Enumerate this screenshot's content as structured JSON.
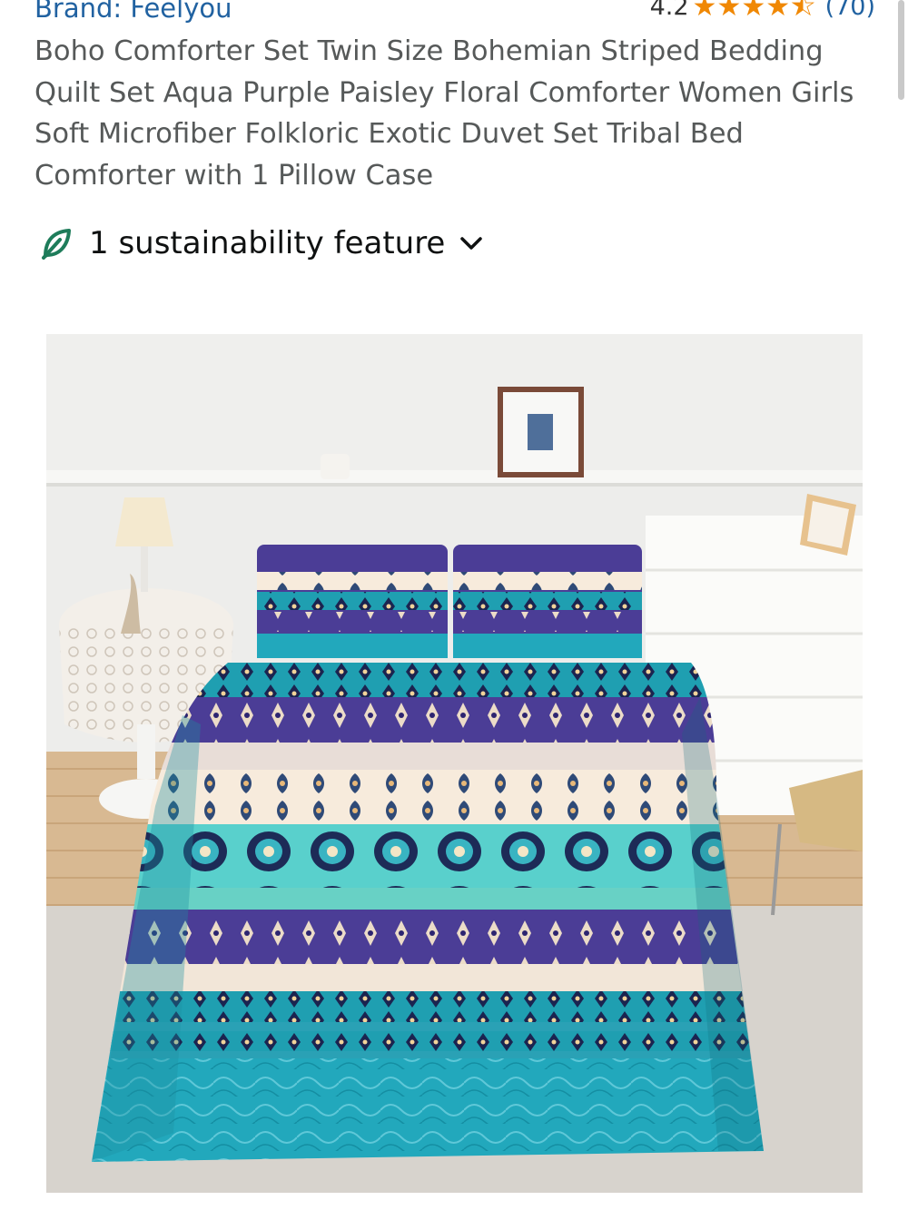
{
  "brand": {
    "label": "Brand: Feelyou"
  },
  "rating": {
    "score": "4.2",
    "stars": 4.2,
    "count": "(70)"
  },
  "product": {
    "title": "Boho Comforter Set Twin Size Bohemian Striped Bedding Quilt Set Aqua Purple Paisley Floral Comforter Women Girls Soft Microfiber Folkloric Exotic Duvet Set Tribal Bed Comforter with 1 Pillow Case"
  },
  "sustainability": {
    "label": "1 sustainability feature",
    "icon": "leaf-icon",
    "chevron": "chevron-down-icon"
  },
  "colors": {
    "brand_link": "#2162a1",
    "star": "#f08804",
    "leaf": "#1e7c5a",
    "teal": "#1aa7b8",
    "purple": "#4a3d8f"
  }
}
